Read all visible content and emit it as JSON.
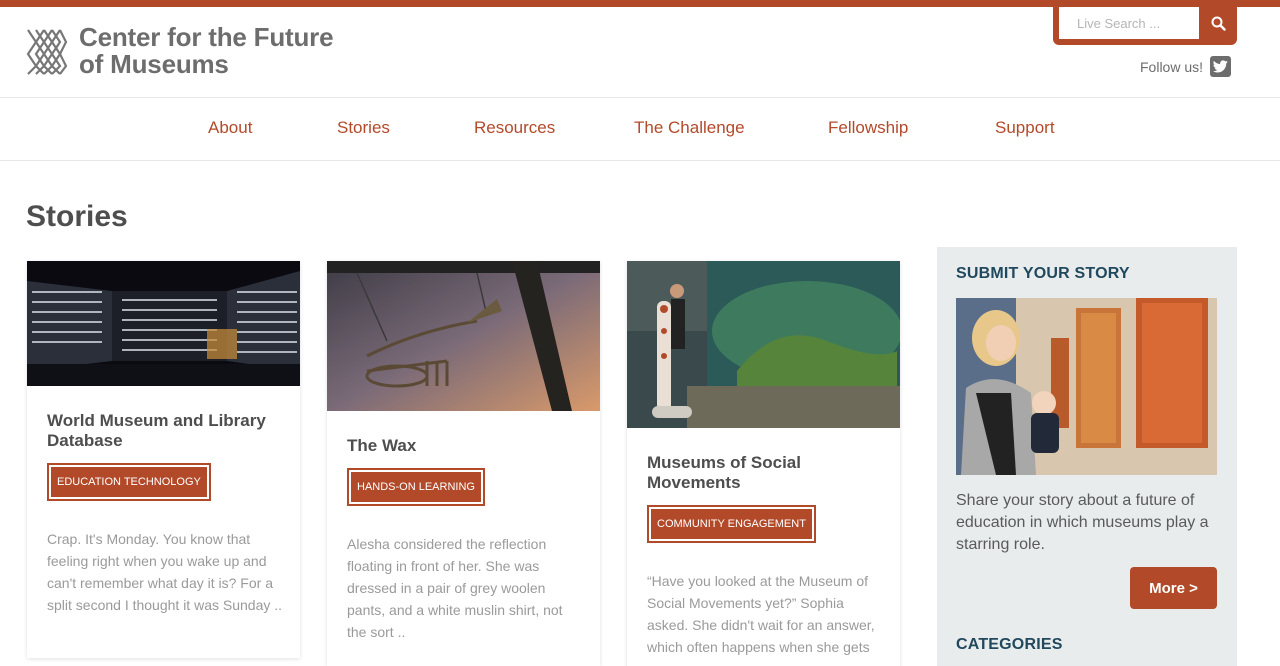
{
  "site": {
    "logo_line1": "Center for the Future",
    "logo_line2": "of Museums",
    "follow_text": "Follow us!"
  },
  "search": {
    "placeholder": "Live Search ..."
  },
  "nav": [
    "About",
    "Stories",
    "Resources",
    "The Challenge",
    "Fellowship",
    "Support"
  ],
  "page_title": "Stories",
  "cards": [
    {
      "title": "World Museum and Library Database",
      "tag": "EDUCATION TECHNOLOGY",
      "excerpt": "Crap.  It's Monday. You know that feeling right when you wake up and can't remember what day it is?  For a split second I thought it was Sunday .."
    },
    {
      "title": "The Wax",
      "tag": "HANDS-ON LEARNING",
      "excerpt": "Alesha considered the reflection floating in front of her. She was dressed in a pair of grey woolen pants, and a white muslin shirt, not the sort .."
    },
    {
      "title": "Museums of Social Movements",
      "tag": "COMMUNITY ENGAGEMENT",
      "excerpt": "“Have you looked at the Museum of Social Movements yet?” Sophia asked. She didn't wait for an answer, which often happens when she gets"
    }
  ],
  "sidebar": {
    "heading": "SUBMIT YOUR STORY",
    "text": "Share your story about a future of education in which museums play a starring role.",
    "button": "More >",
    "categories_heading": "CATEGORIES"
  },
  "colors": {
    "accent": "#b24a2a",
    "sidebar_bg": "#e8eced",
    "heading_dark_blue": "#21485c"
  }
}
